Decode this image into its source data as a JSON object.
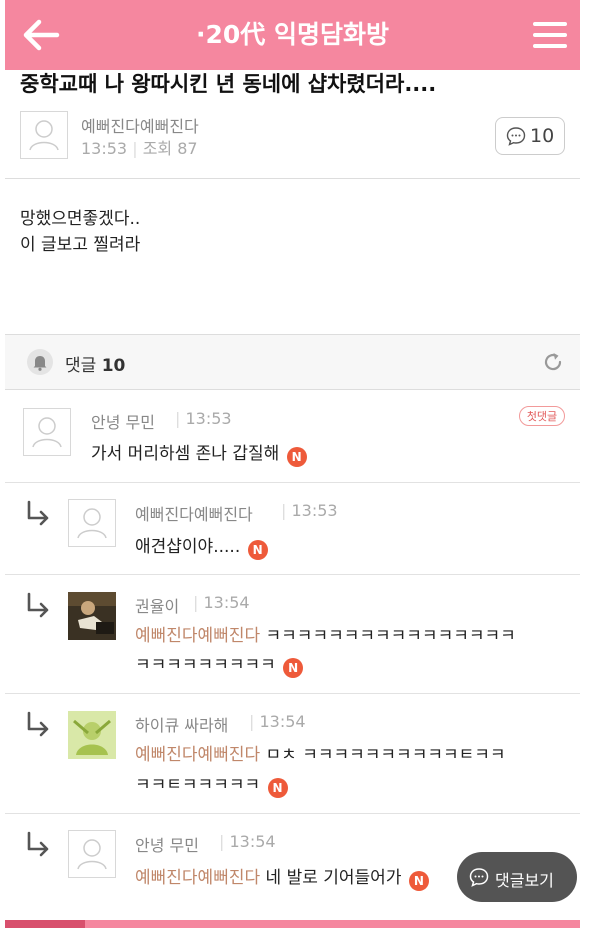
{
  "header": {
    "title": "·20代 익명담화방"
  },
  "post": {
    "title": "중학교때 나 왕따시킨 년 동네에 샵차렸더라....",
    "author": "예뻐진다예뻐진다",
    "time": "13:53",
    "views_label": "조회 87",
    "comment_count": "10",
    "body_lines": [
      "망했으면좋겠다..",
      "이 글보고 찔려라"
    ]
  },
  "comments_bar": {
    "label": "댓글",
    "count": "10"
  },
  "comments": [
    {
      "author": "안녕 무민",
      "time": "13:53",
      "badge": "첫댓글",
      "text": "가서 머리하셈 존나 갑질해",
      "new": "N"
    },
    {
      "author": "예뻐진다예뻐진다",
      "time": "13:53",
      "text": "애견샵이야.....",
      "new": "N"
    },
    {
      "author": "권율이",
      "time": "13:54",
      "mention": "예뻐진다예뻐진다",
      "text": " ㅋㅋㅋㅋㅋㅋㅋㅋㅋㅋㅋㅋㅋㅋㅋㅋ",
      "text2": "ㅋㅋㅋㅋㅋㅋㅋㅋㅋ",
      "new": "N"
    },
    {
      "author": "하이큐 싸라해",
      "time": "13:54",
      "mention": "예뻐진다예뻐진다",
      "text": " ㅁㅊ ㅋㅋㅋㅋㅋㅋㅋㅋㅋㅋㅌㅋㅋ",
      "text2": "ㅋㅋㅌㅋㅋㅋㅋㅋ",
      "new": "N"
    },
    {
      "author": "안녕 무민",
      "time": "13:54",
      "mention": "예뻐진다예뻐진다",
      "text": " 네 발로 기어들어가",
      "new": "N"
    }
  ],
  "float_button": {
    "label": "댓글보기"
  }
}
